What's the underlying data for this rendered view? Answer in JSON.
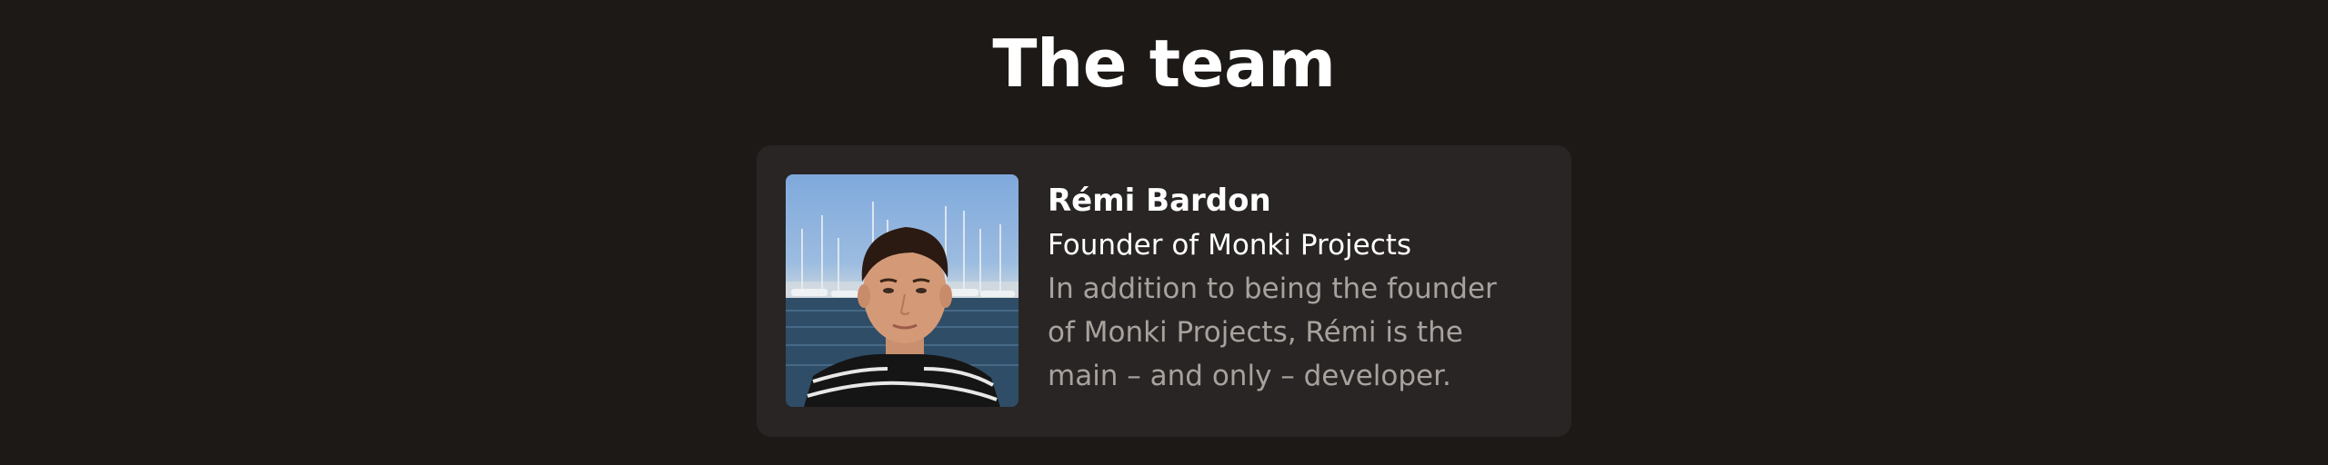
{
  "section": {
    "title": "The team"
  },
  "member": {
    "name": "Rémi Bardon",
    "role": "Founder of Monki Projects",
    "bio": "In addition to being the founder of Monki Projects, Rémi is the main – and only – developer.",
    "photo_alt": "Rémi Bardon"
  },
  "colors": {
    "background": "#1d1917",
    "card": "#292524",
    "heading": "#ffffff",
    "muted_text": "#a8a29e"
  }
}
